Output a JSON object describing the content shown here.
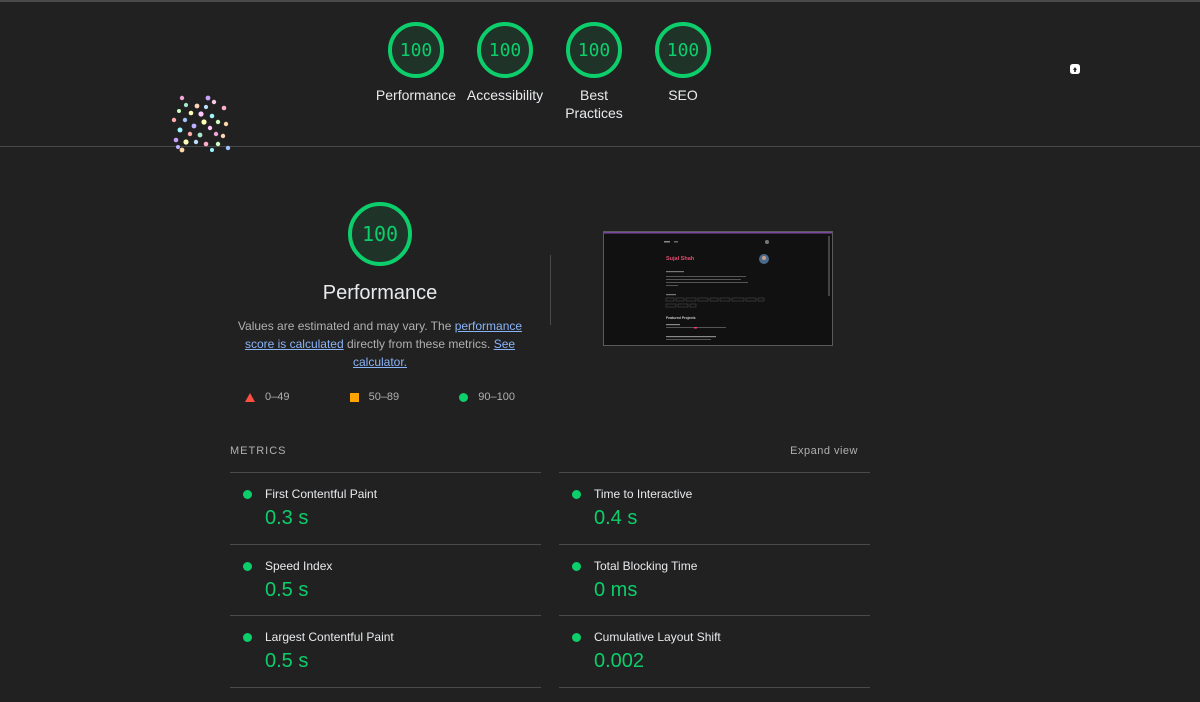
{
  "header": {
    "gauges": [
      {
        "score": "100",
        "label": "Performance"
      },
      {
        "score": "100",
        "label": "Accessibility"
      },
      {
        "score": "100",
        "label": "Best Practices"
      },
      {
        "score": "100",
        "label": "SEO"
      }
    ],
    "tools_icon": "tools-icon"
  },
  "performance": {
    "score": "100",
    "title": "Performance",
    "desc_prefix": "Values are estimated and may vary. The ",
    "link_score": "performance score is calculated",
    "desc_middle": " directly from these metrics. ",
    "link_calc": "See calculator.",
    "legend": [
      {
        "icon": "triangle",
        "range": "0–49",
        "color": "#ff4e42"
      },
      {
        "icon": "square",
        "range": "50–89",
        "color": "#ffa400"
      },
      {
        "icon": "circle",
        "range": "90–100",
        "color": "#0cce6b"
      }
    ]
  },
  "thumbnail": {
    "site_title": "Sujal Shah",
    "section": "Featured Projects"
  },
  "metrics": {
    "title": "METRICS",
    "expand_label": "Expand view",
    "items": [
      {
        "name": "First Contentful Paint",
        "value": "0.3 s"
      },
      {
        "name": "Time to Interactive",
        "value": "0.4 s"
      },
      {
        "name": "Speed Index",
        "value": "0.5 s"
      },
      {
        "name": "Total Blocking Time",
        "value": "0 ms"
      },
      {
        "name": "Largest Contentful Paint",
        "value": "0.5 s"
      },
      {
        "name": "Cumulative Layout Shift",
        "value": "0.002"
      }
    ]
  },
  "colors": {
    "pass": "#0cce6b",
    "background": "#212121",
    "link": "#8ab4f8"
  }
}
